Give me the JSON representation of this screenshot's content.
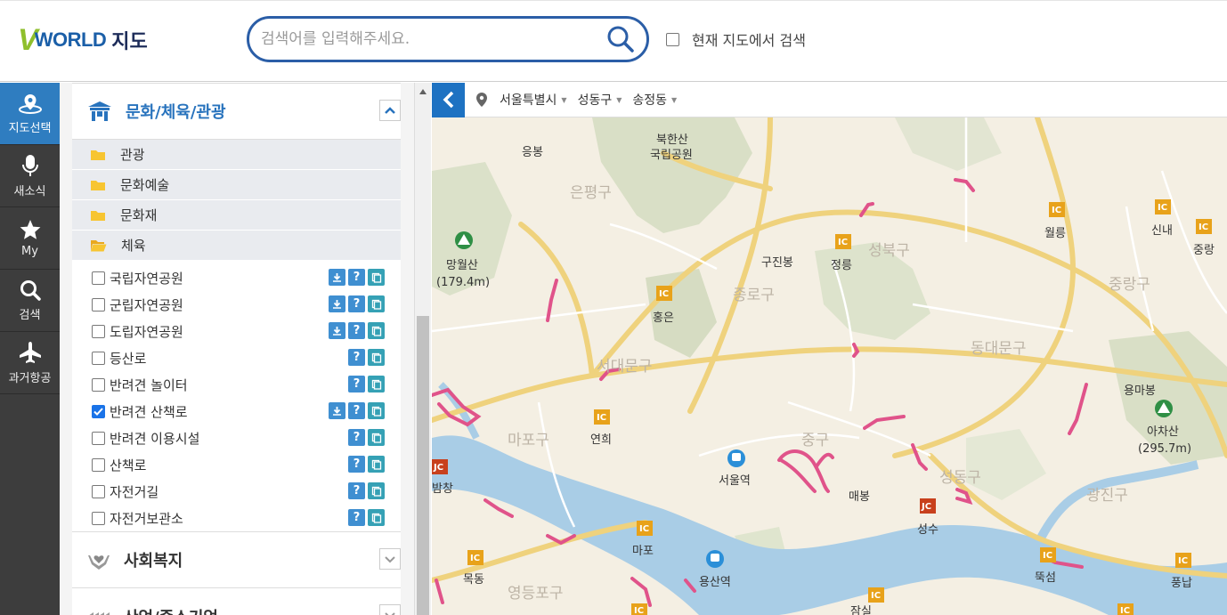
{
  "header": {
    "logo_v": "V",
    "logo_world": "WORLD",
    "logo_suffix": "지도",
    "search_placeholder": "검색어를 입력해주세요.",
    "map_search_label": "현재 지도에서 검색"
  },
  "nav": [
    {
      "label": "지도선택",
      "icon": "map-pin-icon",
      "active": true
    },
    {
      "label": "새소식",
      "icon": "microphone-icon",
      "active": false
    },
    {
      "label": "My",
      "icon": "star-icon",
      "active": false
    },
    {
      "label": "검색",
      "icon": "search-icon",
      "active": false
    },
    {
      "label": "과거항공",
      "icon": "airplane-icon",
      "active": false
    }
  ],
  "panel": {
    "category_open": "문화/체육/관광",
    "folders": [
      "관광",
      "문화예술",
      "문화재",
      "체육"
    ],
    "layers": [
      {
        "label": "국립자연공원",
        "checked": false,
        "download": true
      },
      {
        "label": "군립자연공원",
        "checked": false,
        "download": true
      },
      {
        "label": "도립자연공원",
        "checked": false,
        "download": true
      },
      {
        "label": "등산로",
        "checked": false,
        "download": false
      },
      {
        "label": "반려견 놀이터",
        "checked": false,
        "download": false
      },
      {
        "label": "반려견 산책로",
        "checked": true,
        "download": true
      },
      {
        "label": "반려견 이용시설",
        "checked": false,
        "download": false
      },
      {
        "label": "산책로",
        "checked": false,
        "download": false
      },
      {
        "label": "자전거길",
        "checked": false,
        "download": false
      },
      {
        "label": "자전거보관소",
        "checked": false,
        "download": false
      }
    ],
    "category_welfare": "사회복지",
    "category_industry": "산업/중소기업",
    "help_glyph": "?"
  },
  "map": {
    "region_city": "서울특별시",
    "region_district": "성동구",
    "region_dong": "송정동",
    "labels": {
      "bukhansan": "북한산",
      "bukhansan2": "국립공원",
      "eungbong": "응봉",
      "eunpyeong": "은평구",
      "mangwolsan": "망월산",
      "mangwolsan_h": "(179.4m)",
      "gujinbong": "구진봉",
      "jeongneung": "정릉",
      "seongbuk": "성북구",
      "wolleung": "월릉",
      "sinnae": "신내",
      "jungnang_s": "중랑",
      "jungnang": "중랑구",
      "jongno": "종로구",
      "hongeun": "홍은",
      "seodaemun": "서대문구",
      "dongdaemun": "동대문구",
      "yongmabong": "용마봉",
      "achasan": "아차산",
      "achasan_h": "(295.7m)",
      "mapo": "마포구",
      "yeonhui": "연희",
      "junggu": "중구",
      "seoulstation": "서울역",
      "maebong": "매봉",
      "seongdong": "성동구",
      "gwangjin": "광진구",
      "seongsu": "성수",
      "bamchang": "밤창",
      "mapo_ic": "마포",
      "mokdong": "목동",
      "yongsan": "용산역",
      "yeongdeungpo": "영등포구",
      "ttukseom": "뚝섬",
      "pungnap": "풍납",
      "jamsil": "잠실"
    }
  }
}
